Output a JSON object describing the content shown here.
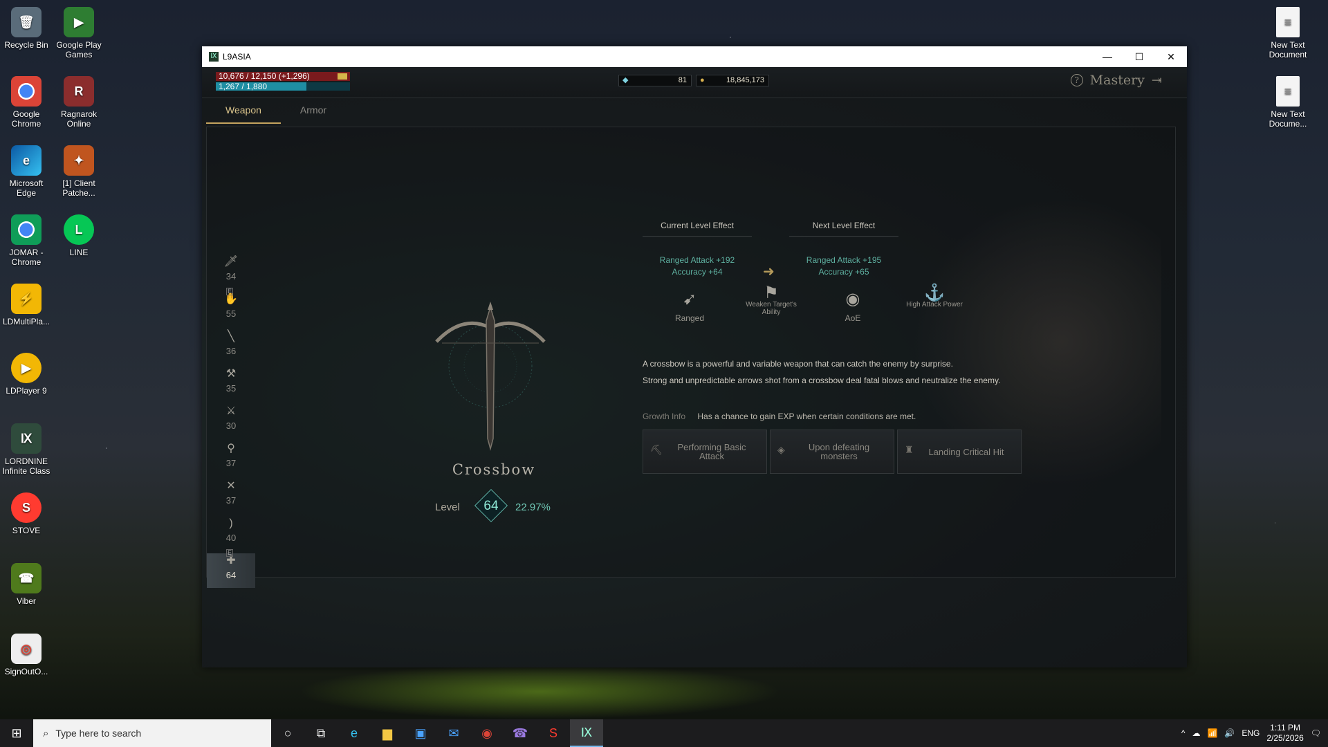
{
  "desktop": {
    "left_icons": [
      {
        "label": "Recycle Bin",
        "icon": "recycle-bin-icon"
      },
      {
        "label": "Google Play Games",
        "icon": "google-play-games-icon"
      },
      {
        "label": "Google Chrome",
        "icon": "chrome-icon"
      },
      {
        "label": "Ragnarok Online",
        "icon": "ragnarok-icon"
      },
      {
        "label": "Microsoft Edge",
        "icon": "edge-icon"
      },
      {
        "label": "[1] Client Patche...",
        "icon": "client-patcher-icon"
      },
      {
        "label": "JOMAR - Chrome",
        "icon": "chrome-profile-icon"
      },
      {
        "label": "LINE",
        "icon": "line-icon"
      },
      {
        "label": "LDMultiPla...",
        "icon": "ldmultiplayer-icon"
      },
      {
        "label": "LDPlayer 9",
        "icon": "ldplayer-icon"
      },
      {
        "label": "LORDNINE Infinite Class",
        "icon": "lordnine-icon"
      },
      {
        "label": "STOVE",
        "icon": "stove-icon"
      },
      {
        "label": "Viber",
        "icon": "viber-icon"
      },
      {
        "label": "SignOutO...",
        "icon": "chrome-shortcut-icon"
      }
    ],
    "right_icons": [
      {
        "label": "New Text Document",
        "icon": "text-document-icon"
      },
      {
        "label": "New Text Docume...",
        "icon": "text-document-icon"
      }
    ]
  },
  "window": {
    "title": "L9ASIA"
  },
  "game": {
    "hp_text": "10,676 / 12,150 (+1,296)",
    "mp_text": "1,267 / 1,880",
    "mp_fraction": 0.674,
    "diamonds": "81",
    "gold": "18,845,173",
    "page_title": "Mastery",
    "tabs": [
      "Weapon",
      "Armor"
    ],
    "weapons": [
      {
        "level": "34",
        "icon": "dagger-icon"
      },
      {
        "level": "55",
        "icon": "claw-icon",
        "badge": "E"
      },
      {
        "level": "36",
        "icon": "spear-icon"
      },
      {
        "level": "35",
        "icon": "axe-icon"
      },
      {
        "level": "30",
        "icon": "sword-icon"
      },
      {
        "level": "37",
        "icon": "wand-icon"
      },
      {
        "level": "37",
        "icon": "dual-blade-icon"
      },
      {
        "level": "40",
        "icon": "bow-icon"
      },
      {
        "level": "64",
        "icon": "crossbow-icon",
        "badge": "E",
        "active": true
      }
    ],
    "weapon_name": "Crossbow",
    "level_label": "Level",
    "level": "64",
    "level_progress": "22.97%",
    "current_effect": {
      "header": "Current Level Effect",
      "line1": "Ranged Attack +192",
      "line2": "Accuracy +64"
    },
    "next_effect": {
      "header": "Next Level Effect",
      "line1": "Ranged Attack +195",
      "line2": "Accuracy +65"
    },
    "attributes": [
      {
        "label": "Ranged",
        "icon": "ranged-icon"
      },
      {
        "label": "Weaken Target's Ability",
        "icon": "weaken-icon"
      },
      {
        "label": "AoE",
        "icon": "aoe-icon"
      },
      {
        "label": "High Attack Power",
        "icon": "high-attack-icon"
      }
    ],
    "description": [
      "A crossbow is a powerful and variable weapon that can catch the enemy by surprise.",
      "Strong and unpredictable arrows shot from a crossbow deal fatal blows and neutralize the enemy."
    ],
    "growth_label": "Growth Info",
    "growth_text": "Has a chance to gain EXP when certain conditions are met.",
    "growth_conditions": [
      "Performing Basic Attack",
      "Upon defeating monsters",
      "Landing Critical Hit"
    ]
  },
  "taskbar": {
    "search_placeholder": "Type here to search",
    "language": "ENG",
    "time": "1:11 PM",
    "date": "2/25/2026"
  }
}
